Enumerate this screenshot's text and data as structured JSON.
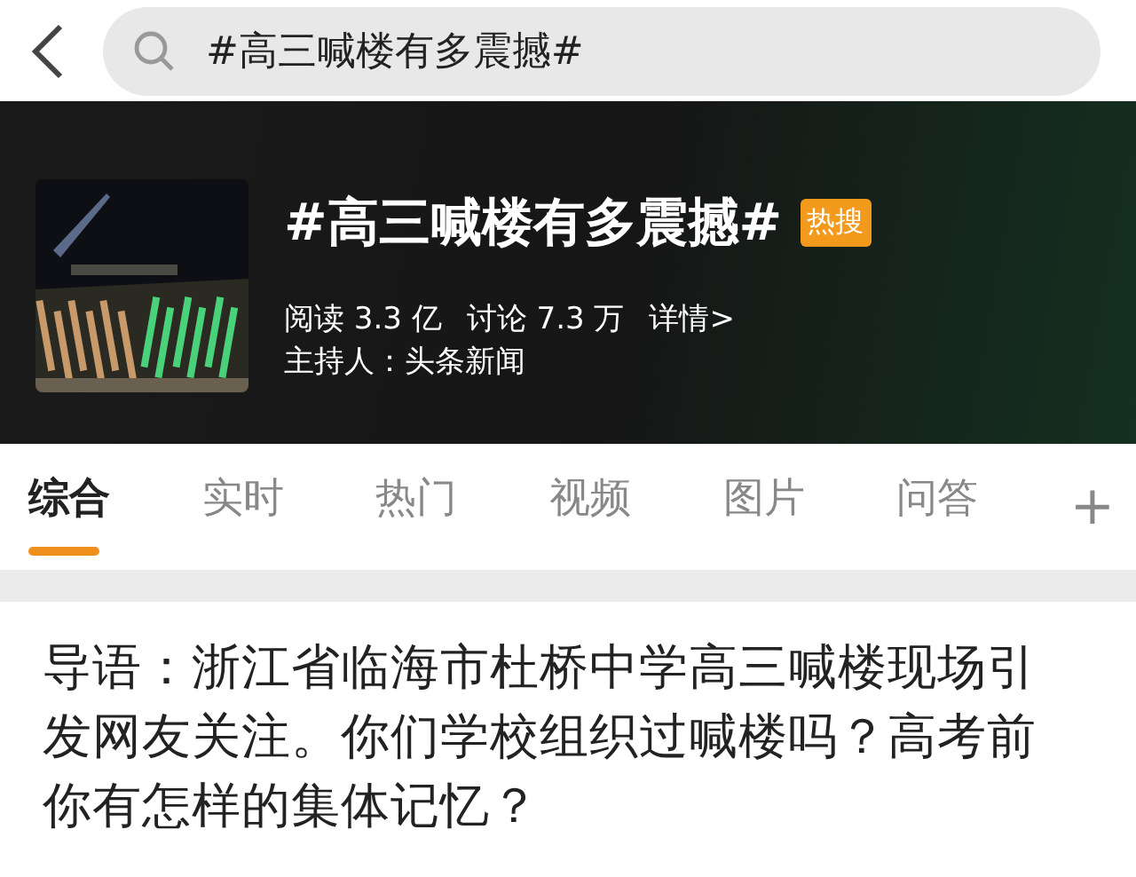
{
  "search": {
    "value": "#高三喊楼有多震撼#"
  },
  "topic": {
    "title": "#高三喊楼有多震撼#",
    "badge": "热搜",
    "reads": "阅读 3.3 亿",
    "discussions": "讨论 7.3 万",
    "details": "详情>",
    "host": "主持人：头条新闻"
  },
  "tabs": [
    {
      "label": "综合",
      "selected": true
    },
    {
      "label": "实时",
      "selected": false
    },
    {
      "label": "热门",
      "selected": false
    },
    {
      "label": "视频",
      "selected": false
    },
    {
      "label": "图片",
      "selected": false
    },
    {
      "label": "问答",
      "selected": false
    }
  ],
  "add_tab": "+",
  "intro": "导语：浙江省临海市杜桥中学高三喊楼现场引发网友关注。你们学校组织过喊楼吗？高考前你有怎样的集体记忆？"
}
